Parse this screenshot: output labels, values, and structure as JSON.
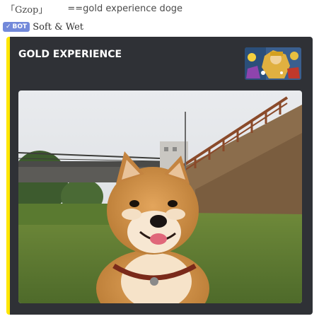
{
  "command": {
    "open_quote": "「Gzop」",
    "text": "==gold experience doge"
  },
  "author": {
    "bot_tag_icon": "checkmark-icon",
    "bot_tag": "BOT",
    "name": "Soft & Wet"
  },
  "embed": {
    "accent_color": "#ffe600",
    "background_color": "#2f3136",
    "title": "GOLD EXPERIENCE",
    "thumbnail": "gold-experience-stand-thumbnail",
    "image": "shiba-inu-doge-photo"
  }
}
